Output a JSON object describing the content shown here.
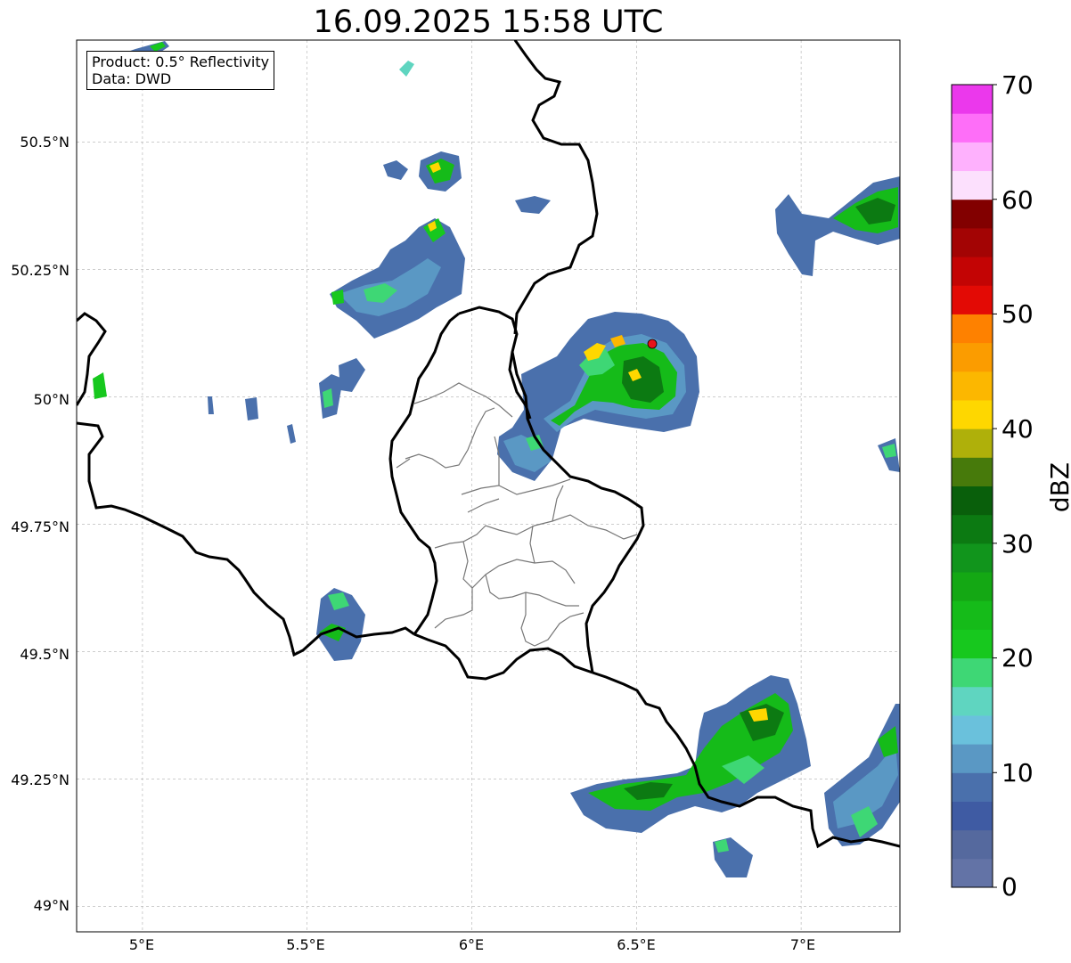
{
  "title": "16.09.2025 15:58 UTC",
  "info": {
    "product": "Product: 0.5° Reflectivity",
    "data_source": "Data: DWD"
  },
  "axes": {
    "lat_ticks": [
      "50.5°N",
      "50.25°N",
      "50°N",
      "49.75°N",
      "49.5°N",
      "49.25°N",
      "49°N"
    ],
    "lon_ticks": [
      "5°E",
      "5.5°E",
      "6°E",
      "6.5°E",
      "7°E"
    ],
    "lat_range": [
      48.95,
      50.7
    ],
    "lon_range": [
      4.8,
      7.3
    ],
    "grid": true
  },
  "radar_site": {
    "lon": 6.55,
    "lat": 50.11,
    "color": "#e8141b"
  },
  "colorbar": {
    "label": "dBZ",
    "ticks": [
      "0",
      "10",
      "20",
      "30",
      "40",
      "50",
      "60",
      "70"
    ],
    "min": 0,
    "max": 70,
    "step": 2.5,
    "colors": [
      "#6373a6",
      "#55699e",
      "#3f5ba3",
      "#4a70ac",
      "#5a98c4",
      "#6ac1dc",
      "#5fd5c0",
      "#3ed775",
      "#17c81e",
      "#15bb19",
      "#14a814",
      "#11951c",
      "#0c7a12",
      "#095f0b",
      "#477a0b",
      "#afb00a",
      "#fed700",
      "#fcb700",
      "#fb9c00",
      "#fe8100",
      "#e30a05",
      "#c30404",
      "#a30404",
      "#820000",
      "#fce0fd",
      "#feb1fd",
      "#fe6ef8",
      "#eb38ec"
    ]
  }
}
